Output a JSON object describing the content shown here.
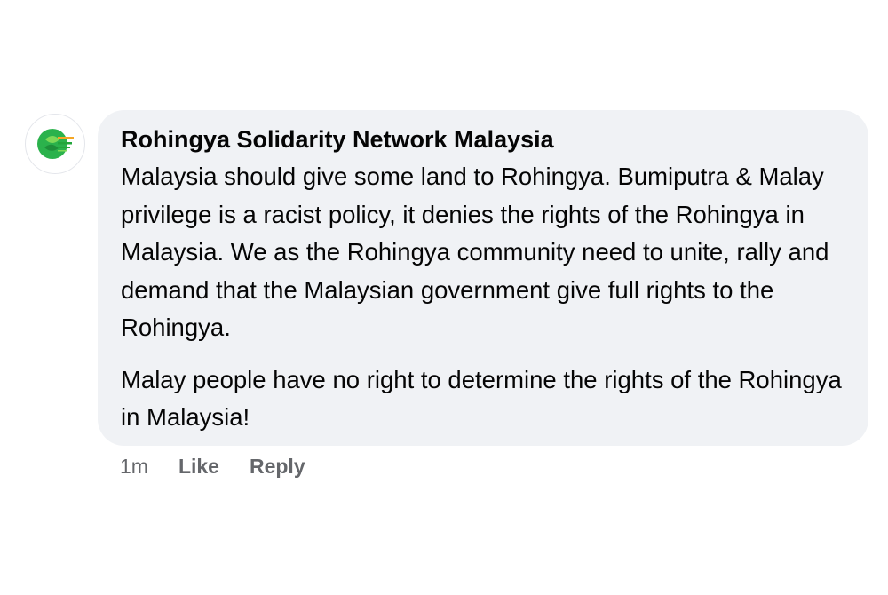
{
  "comment": {
    "author": "Rohingya Solidarity Network Malaysia",
    "avatar_icon": "organization-logo-icon",
    "brand_colors": {
      "green": "#22a63b",
      "orange": "#f5a623",
      "bubble": "#f0f2f5"
    },
    "paragraphs": [
      "Malaysia should give some land to Rohingya. Bumiputra & Malay privilege is a racist policy, it denies the rights of the Rohingya in Malaysia. We as the Rohingya community need to unite, rally and demand that the Malaysian government give full rights to the Rohingya.",
      "Malay people have no right to determine the rights of the Rohingya in Malaysia!"
    ],
    "timestamp": "1m",
    "like_label": "Like",
    "reply_label": "Reply"
  }
}
